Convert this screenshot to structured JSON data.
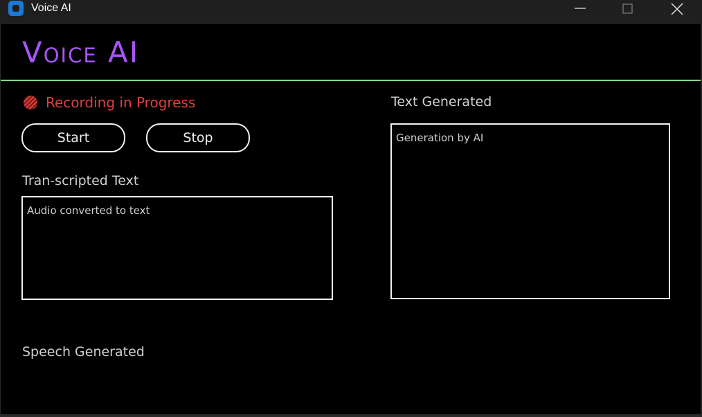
{
  "window": {
    "title": "Voice AI",
    "icon": "app-icon",
    "controls": [
      "minimize-icon",
      "maximize-icon",
      "close-icon"
    ]
  },
  "header": {
    "title": "Voice AI",
    "accent_color": "#a855f7",
    "divider_color": "#84d88a"
  },
  "status": {
    "icon": "record-icon",
    "label": "Recording in Progress",
    "color": "#e0403c"
  },
  "controls": {
    "start_label": "Start",
    "stop_label": "Stop"
  },
  "transcription": {
    "label": "Tran-scripted Text",
    "value": "Audio converted to text"
  },
  "generation": {
    "label": "Text Generated",
    "value": "Generation by AI"
  },
  "speech": {
    "label": "Speech Generated"
  }
}
